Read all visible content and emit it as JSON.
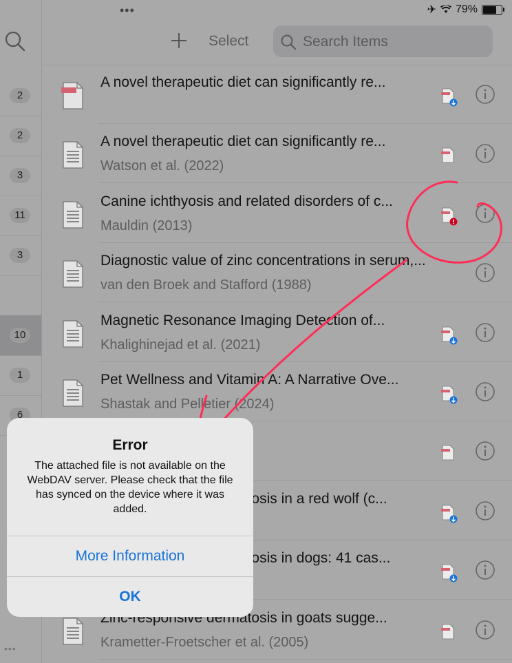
{
  "status_bar": {
    "battery": "79%",
    "battery_level": 0.79
  },
  "left_counts": [
    {
      "value": "2",
      "selected": false
    },
    {
      "value": "2",
      "selected": false
    },
    {
      "value": "3",
      "selected": false
    },
    {
      "value": "11",
      "selected": false
    },
    {
      "value": "3",
      "selected": false
    },
    {
      "value": "",
      "selected": false
    },
    {
      "value": "10",
      "selected": true
    },
    {
      "value": "1",
      "selected": false
    },
    {
      "value": "6",
      "selected": false
    }
  ],
  "toolbar": {
    "select_label": "Select",
    "search_placeholder": "Search Items"
  },
  "items": [
    {
      "title": "A novel therapeutic diet can significantly re...",
      "creator": "",
      "item_type": "pdf",
      "attachment": "pdf-download"
    },
    {
      "title": "A novel therapeutic diet can significantly re...",
      "creator": "Watson et al. (2022)",
      "item_type": "article",
      "attachment": "pdf"
    },
    {
      "title": "Canine ichthyosis and related disorders of c...",
      "creator": "Mauldin (2013)",
      "item_type": "article",
      "attachment": "pdf-error"
    },
    {
      "title": "Diagnostic value of zinc concentrations in serum,...",
      "creator": "van den Broek and Stafford (1988)",
      "item_type": "article",
      "attachment": "none"
    },
    {
      "title": "Magnetic Resonance Imaging Detection of...",
      "creator": "Khalighinejad et al. (2021)",
      "item_type": "article",
      "attachment": "pdf-download"
    },
    {
      "title": "Pet Wellness and Vitamin A: A Narrative Ove...",
      "creator": "Shastak and Pelletier (2024)",
      "item_type": "article",
      "attachment": "pdf-download"
    },
    {
      "title": "",
      "creator": "",
      "item_type": "article",
      "attachment": "pdf"
    },
    {
      "title": "Zinc-responsive dermatosis in a red wolf (c...",
      "creator": "",
      "item_type": "article",
      "attachment": "pdf-download"
    },
    {
      "title": "Zinc-responsive dermatosis in dogs: 41 cas...",
      "creator": "",
      "item_type": "article",
      "attachment": "pdf-download"
    },
    {
      "title": "Zinc-responsive dermatosis in goats sugge...",
      "creator": "Krametter-Froetscher et al. (2005)",
      "item_type": "article",
      "attachment": "pdf"
    }
  ],
  "alert": {
    "title": "Error",
    "message": "The attached file is not available on the WebDAV server. Please check that the file has synced on the device where it was added.",
    "more_info_label": "More Information",
    "ok_label": "OK"
  },
  "colors": {
    "accent": "#1a73d9",
    "annotation": "#ff2d55",
    "error": "#d0021b"
  }
}
